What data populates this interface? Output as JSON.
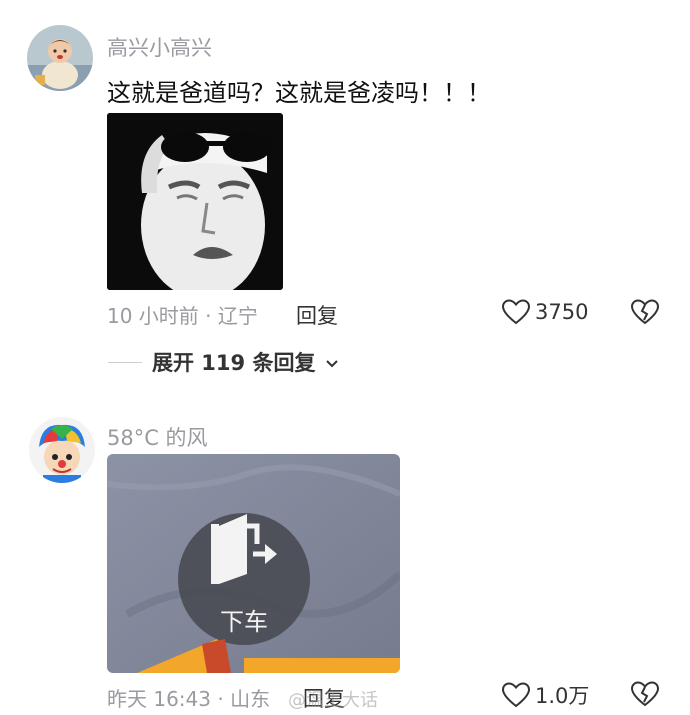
{
  "comments": [
    {
      "username": "高兴小高兴",
      "text": "这就是爸道吗？这就是爸凌吗！！！",
      "media_description": "sunglasses-salute-meme",
      "meta": "10 小时前 · 辽宁",
      "reply_label": "回复",
      "likes": "3750",
      "expand_label": "展开 119 条回复"
    },
    {
      "username": "58°C 的风",
      "media_label": "下车",
      "meta": "昨天 16:43 · 山东",
      "reply_label": "回复",
      "likes": "1.0万"
    }
  ],
  "watermark": "@温王大话",
  "icons": {
    "like": "heart-outline-icon",
    "dislike": "broken-heart-icon",
    "expand": "chevron-down-icon",
    "exit": "car-door-exit-icon"
  }
}
